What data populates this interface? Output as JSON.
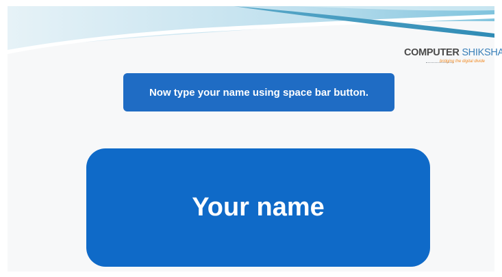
{
  "logo": {
    "main_part1": "COMPUTER",
    "main_part2": "SHIKSHA",
    "tagline": "bridging the digital divide"
  },
  "instruction": {
    "text": "Now type your name using space bar button."
  },
  "name_box": {
    "text": "Your name"
  },
  "colors": {
    "box_blue": "#0f6ac8",
    "wave_light": "#cfe8f3",
    "wave_teal": "#4aa8c8",
    "logo_accent": "#3a80b9"
  }
}
